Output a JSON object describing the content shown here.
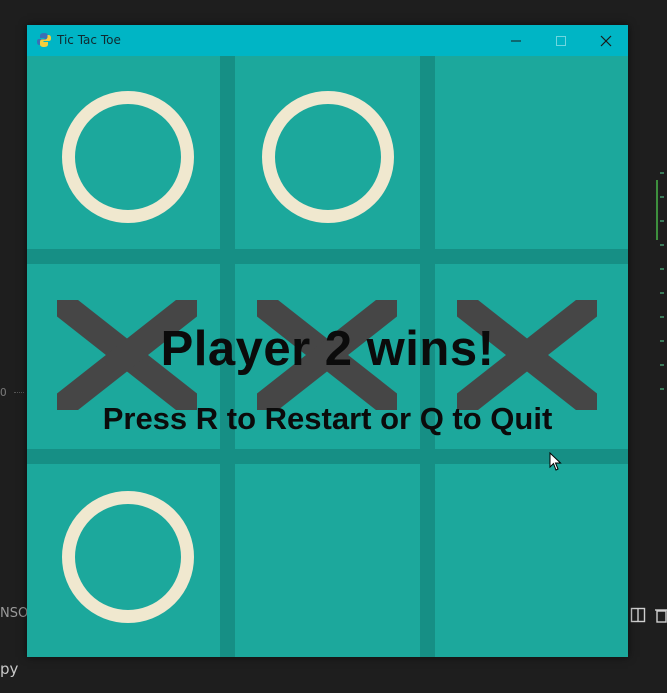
{
  "window": {
    "title": "Tic Tac Toe",
    "controls": [
      "minimize",
      "maximize",
      "close"
    ]
  },
  "board": {
    "cells": [
      "O",
      "O",
      "",
      "X",
      "X",
      "X",
      "O",
      "",
      ""
    ]
  },
  "message": {
    "result": "Player 2 wins!",
    "instructions": "Press R to Restart or Q to Quit"
  },
  "background": {
    "console_label": "NSOL",
    "file_label": "py",
    "output_marker": "O"
  },
  "colors": {
    "titlebar": "#00b5c5",
    "board": "#1ca89c",
    "grid_line": "#168f85",
    "o_mark": "#f0e8cf",
    "x_mark": "#464646",
    "text": "#0b0b0b"
  }
}
